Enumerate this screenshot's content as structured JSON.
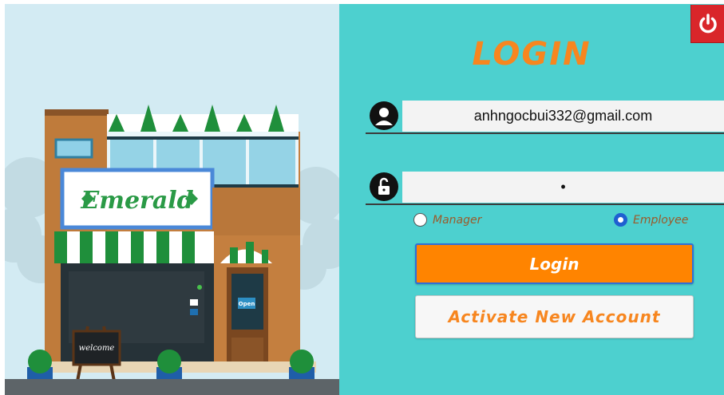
{
  "illustration": {
    "shop_sign": "Emerald",
    "door_sign": "Open",
    "board_text": "welcome"
  },
  "login_panel": {
    "title": "LOGIN",
    "close_icon": "power-icon",
    "username": {
      "icon": "user-icon",
      "value": "anhngocbui332@gmail.com"
    },
    "password": {
      "icon": "unlock-icon",
      "masked_value": "•"
    },
    "roles": [
      {
        "label": "Manager",
        "selected": false
      },
      {
        "label": "Employee",
        "selected": true
      }
    ],
    "login_button": "Login",
    "activate_button": "Activate New Account"
  },
  "colors": {
    "panel_bg": "#4dd0cf",
    "accent_orange": "#ff8400",
    "title_orange": "#f7861f",
    "radio_blue": "#1f5fd1",
    "close_red": "#d9262a"
  }
}
